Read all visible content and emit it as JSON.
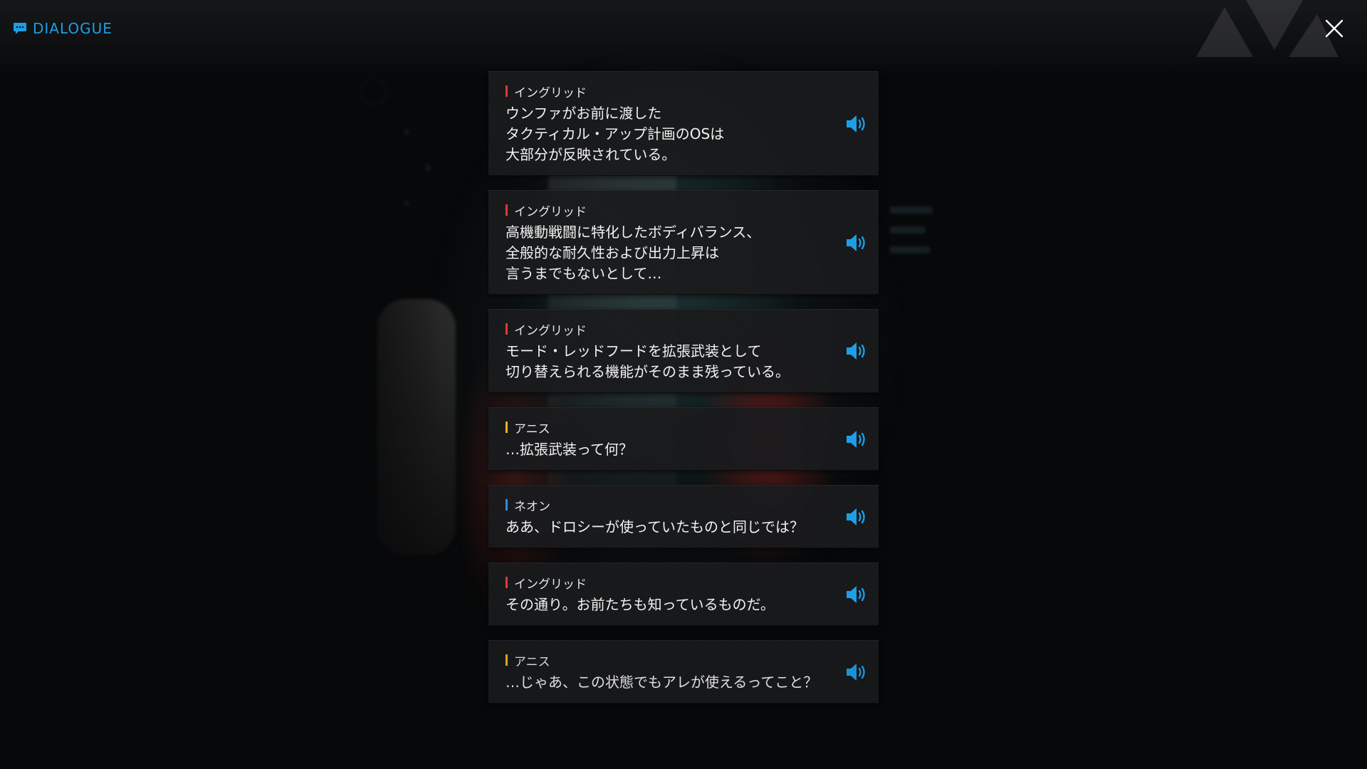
{
  "header": {
    "title": "DIALOGUE",
    "title_icon": "chat-bubble-icon",
    "close_icon": "close-icon",
    "accent": "#1e9ee6"
  },
  "speaker_colors": {
    "ingrid": "#e03a3a",
    "anis": "#f0b020",
    "neon": "#2a8fe0"
  },
  "entries": [
    {
      "speaker": "イングリッド",
      "color": "#e03a3a",
      "lines": [
        "ウンファがお前に渡した",
        "タクティカル・アップ計画のOSは",
        "大部分が反映されている。"
      ]
    },
    {
      "speaker": "イングリッド",
      "color": "#e03a3a",
      "lines": [
        "高機動戦闘に特化したボディバランス、",
        "全般的な耐久性および出力上昇は",
        "言うまでもないとして…"
      ]
    },
    {
      "speaker": "イングリッド",
      "color": "#e03a3a",
      "lines": [
        "モード・レッドフードを拡張武装として",
        "切り替えられる機能がそのまま残っている。"
      ]
    },
    {
      "speaker": "アニス",
      "color": "#f0b020",
      "lines": [
        "…拡張武装って何？"
      ]
    },
    {
      "speaker": "ネオン",
      "color": "#2a8fe0",
      "lines": [
        "ああ、ドロシーが使っていたものと同じでは？"
      ]
    },
    {
      "speaker": "イングリッド",
      "color": "#e03a3a",
      "lines": [
        "その通り。お前たちも知っているものだ。"
      ]
    },
    {
      "speaker": "アニス",
      "color": "#f0b020",
      "lines": [
        "…じゃあ、この状態でもアレが使えるってこと？"
      ]
    }
  ],
  "voice_icon": "speaker-volume-icon",
  "voice_icon_color": "#1e9ee6"
}
